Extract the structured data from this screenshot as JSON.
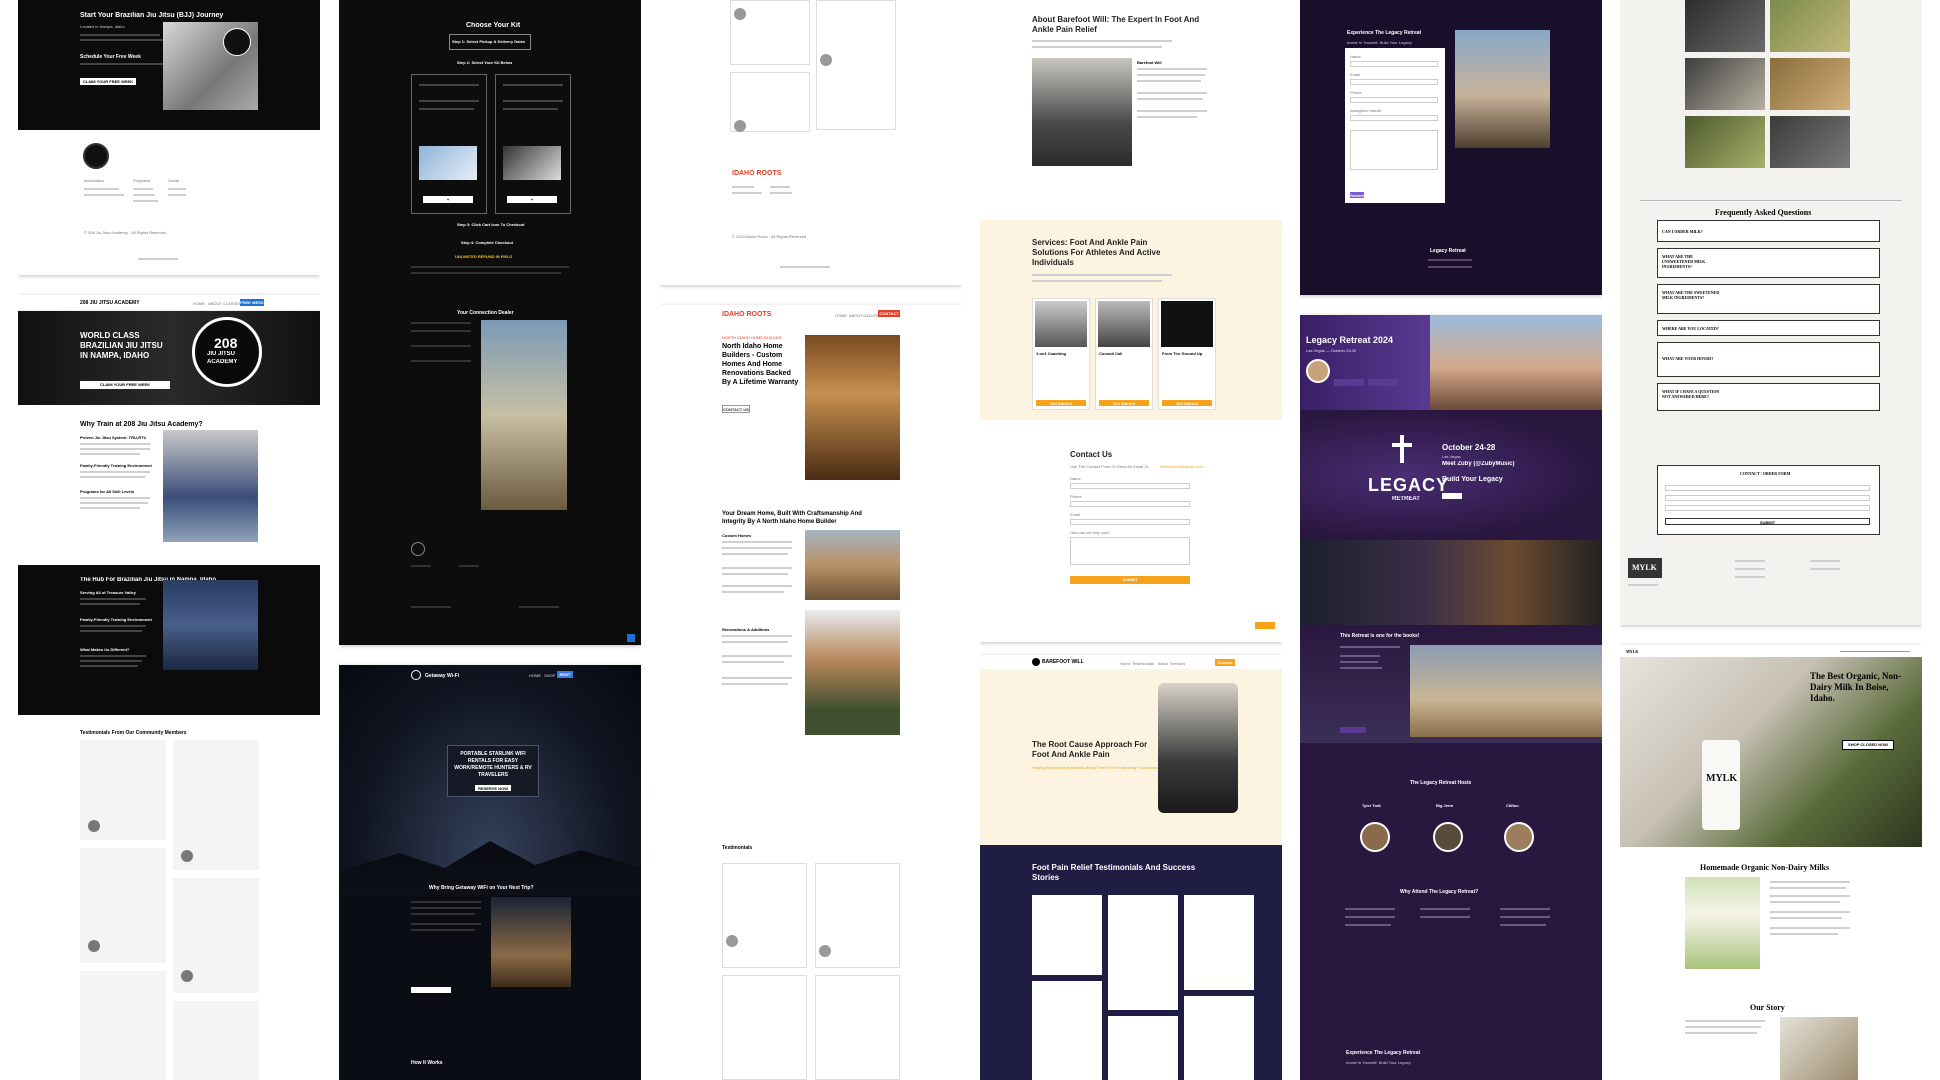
{
  "colors": {
    "bjj_dark": "#0b0b0b",
    "kit_dark": "#0d0d0d",
    "builder_orange": "#e0402a",
    "barefoot_orange": "#f7a21b",
    "barefoot_navy": "#1f1d44",
    "legacy_purple": "#2a1740",
    "mylk_cream": "#f3f2ee"
  },
  "bjj": {
    "hero_title": "Start Your Brazilian Jiu Jitsu (BJJ) Journey",
    "hero_sub": "Located in Nampa, Idaho",
    "schedule": "Schedule Your Free Week",
    "hero_cta": "CLAIM YOUR FREE WEEK",
    "badge": "208 JIU JITSU ACADEMY",
    "footer_cols": [
      "Information",
      "Programs",
      "Social"
    ],
    "copyright": "© 208 Jiu Jitsu Academy · All Rights Reserved",
    "nav_logo": "208 JIU JITSU ACADEMY",
    "nav_items": [
      "HOME",
      "ABOUT",
      "CLASSES",
      "SCHEDULE"
    ],
    "nav_cta": "FREE WEEK",
    "h1": "WORLD CLASS BRAZILIAN JIU JITSU IN NAMPA, IDAHO",
    "h1_cta": "CLAIM YOUR FREE WEEK",
    "seal_top": "208",
    "seal_mid": "JIU JITSU",
    "seal_bot": "ACADEMY",
    "why_title": "Why Train at 208 Jiu Jitsu Academy?",
    "why_p1": "Proven Jiu Jitsu System: TRU-RTU",
    "why_p2": "Family-Friendly Training Environment",
    "why_p3": "Programs for All Skill Levels",
    "hub_title": "The Hub For Brazilian Jiu Jitsu in Nampa, Idaho",
    "hub_p1": "Serving All of Treasure Valley",
    "hub_p2": "Family-Friendly Training Environment",
    "hub_p3": "What Makes Us Different?",
    "test_title": "Testimonials From Our Community Members"
  },
  "kit": {
    "title": "Choose Your Kit",
    "step1": "Step 1: Select Pickup & Delivery Dates",
    "step2": "Step 2: Select Your Kit Below",
    "step3": "Step 3: Click Cart Icon To Checkout",
    "step4": "Step 4: Complete Checkout",
    "refund": "UNLIMITED REFUND IN FIELD",
    "dealer_title": "Your Connection Dealer",
    "gw_logo": "Getaway Wi-Fi",
    "gw_nav": [
      "HOME",
      "SHOP",
      "FAQ"
    ],
    "gw_cta": "RENT",
    "gw_hero": "PORTABLE STARLINK WIFI RENTALS FOR EASY WORK/REMOTE HUNTERS & RV TRAVELERS",
    "gw_hero_cta": "RESERVE NOW",
    "gw_why": "Why Bring Getaway WiFi on Your Next Trip?",
    "gw_how": "How It Works"
  },
  "builder": {
    "logo": "IDAHO ROOTS",
    "nav": [
      "HOME",
      "ABOUT",
      "GALLERY"
    ],
    "nav_cta": "CONTACT",
    "tag": "NORTH IDAHO HOME BUILDER",
    "hero": "North Idaho Home Builders - Custom Homes And Home Renovations Backed By A Lifetime Warranty",
    "hero_cta": "CONTACT US",
    "sec2": "Your Dream Home, Built With Craftsmanship And Integrity By A North Idaho Home Builder",
    "custom": "Custom Homes",
    "reno": "Renovations & Additions",
    "testimonials": "Testimonials",
    "footer_copy": "© 2024 Idaho Roots · All Rights Reserved"
  },
  "barefoot": {
    "about_title": "About Barefoot Will: The Expert In Foot And Ankle Pain Relief",
    "about_name": "Barefoot Will",
    "services_title": "Services: Foot And Ankle Pain Solutions For Athletes And Active Individuals",
    "service_cards": [
      "1:on1 Coaching",
      "Consult Call",
      "From The Ground Up"
    ],
    "card_cta": "Get Started",
    "contact_title": "Contact Us",
    "contact_sub": "Use The Contact Form Or Send An Email To",
    "email": "Barefootwill@gmail.com",
    "form_fields": [
      "Name",
      "Phone",
      "Email",
      "How can we help you?"
    ],
    "submit": "SUBMIT",
    "logo": "BAREFOOT WILL",
    "nav": [
      "Home",
      "Testimonials",
      "About",
      "Services",
      "About Will"
    ],
    "nav_cta": "Contact",
    "hero": "The Root Cause Approach For Foot And Ankle Pain",
    "hero_sub": "Helping Recreational Athletes Break Free From Frustrating Foundational Injuries",
    "test_title": "Foot Pain Relief Testimonials And Success Stories"
  },
  "legacy": {
    "top_title": "Experience The Legacy Retreat",
    "top_sub": "Invest In Yourself. Build Your Legacy",
    "form_fields": [
      "Name",
      "Email",
      "Phone",
      "Instagram Handle"
    ],
    "form_submit": "Submit",
    "footer_title": "Legacy Retreat",
    "hero_title": "Legacy Retreat 2024",
    "hero_sub": "Las Vegas — October 24-28",
    "date": "October 24-28",
    "city": "Las Vegas",
    "meet": "Meet Zuby (@ZubyMusic)",
    "build": "Build Your Legacy",
    "logo_word": "LEGACY",
    "logo_sub": "RETREAT",
    "books": "This Retreat is one for the books!",
    "hosts_title": "The Legacy Retreat Hosts",
    "hosts": [
      "Tyler Todt",
      "Big Jerm",
      "Clifton"
    ],
    "why_title": "Why Attend The Legacy Retreat?",
    "bottom_title": "Experience The Legacy Retreat",
    "bottom_sub": "Invest In Yourself. Build Your Legacy"
  },
  "mylk": {
    "faq_title": "Frequently Asked Questions",
    "faq": [
      "CAN I ORDER MILK?",
      "WHAT ARE THE UNSWEETENED MILK INGREDIENTS?",
      "WHAT ARE THE SWEETENED MILK INGREDIENTS?",
      "WHERE ARE YOU LOCATED?",
      "WHAT ARE YOUR HOURS?",
      "WHAT IF I HAVE A QUESTION NOT ANSWERED HERE?"
    ],
    "order_title": "CONTACT / ORDER FORM",
    "order_submit": "SUBMIT",
    "logo": "MYLK",
    "hero": "The Best Organic, Non-Dairy Milk In Boise, Idaho.",
    "hero_cta": "SHOP CLOSED NOW",
    "milk_title": "Homemade Organic Non-Dairy Milks",
    "story_title": "Our Story",
    "jar_label": "MYLK"
  }
}
